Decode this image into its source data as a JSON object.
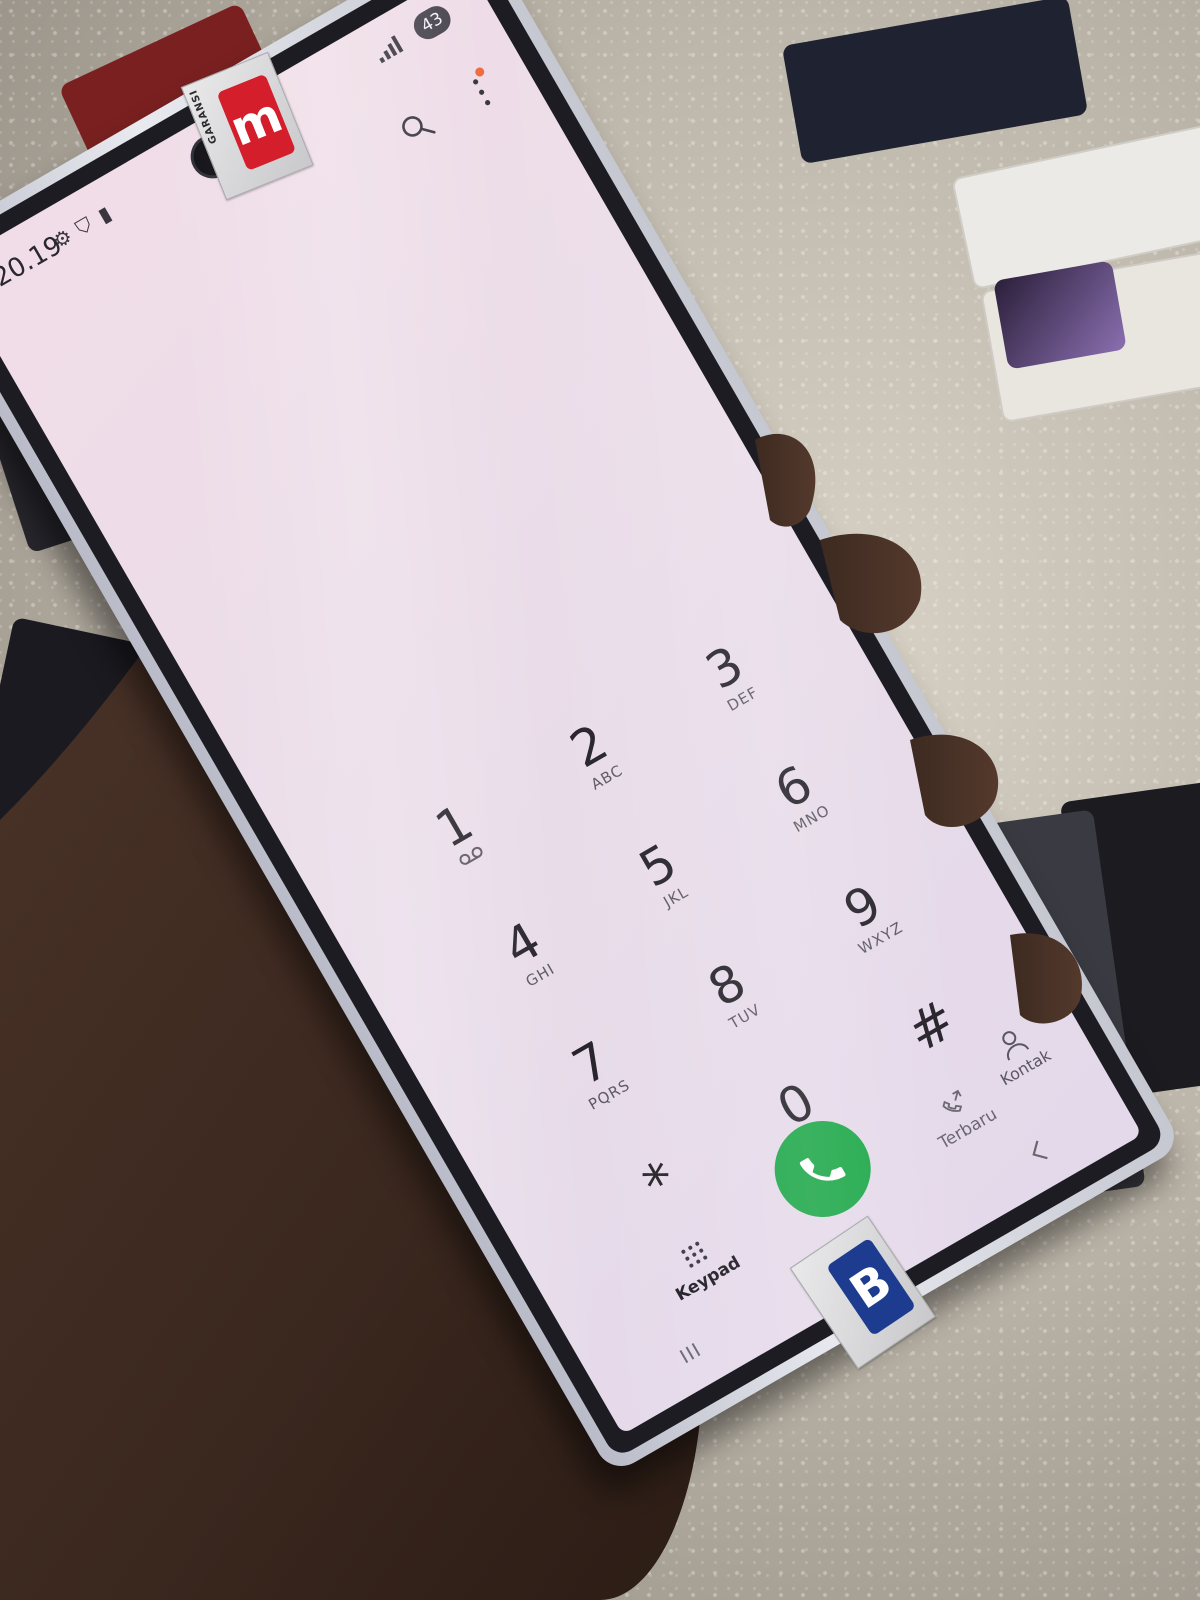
{
  "status_bar": {
    "time": "20.19",
    "battery": "43"
  },
  "icons": {
    "search": "search-icon",
    "more": "more-vertical-icon",
    "call": "phone-icon",
    "contacts": "person-icon",
    "keypad": "dialpad-icon",
    "recents": "recent-calls-icon"
  },
  "keypad": {
    "keys": [
      {
        "digit": "1",
        "letters": "voicemail"
      },
      {
        "digit": "2",
        "letters": "ABC"
      },
      {
        "digit": "3",
        "letters": "DEF"
      },
      {
        "digit": "4",
        "letters": "GHI"
      },
      {
        "digit": "5",
        "letters": "JKL"
      },
      {
        "digit": "6",
        "letters": "MNO"
      },
      {
        "digit": "7",
        "letters": "PQRS"
      },
      {
        "digit": "8",
        "letters": "TUV"
      },
      {
        "digit": "9",
        "letters": "WXYZ"
      },
      {
        "digit": "*",
        "letters": ""
      },
      {
        "digit": "0",
        "letters": "+"
      },
      {
        "digit": "#",
        "letters": ""
      }
    ]
  },
  "shortcuts": {
    "contacts_label": "Kontak"
  },
  "tabs": [
    {
      "label": "Keypad",
      "active": true
    },
    {
      "label": "Terbaru",
      "active": false
    }
  ],
  "stickers": {
    "top_text": "GARANSI",
    "top_logo": "m",
    "bottom_logo": "B"
  },
  "colors": {
    "call_green": "#1fa84a",
    "screen_tint": "#ecdde8",
    "notification_dot": "#ef6b3f"
  }
}
